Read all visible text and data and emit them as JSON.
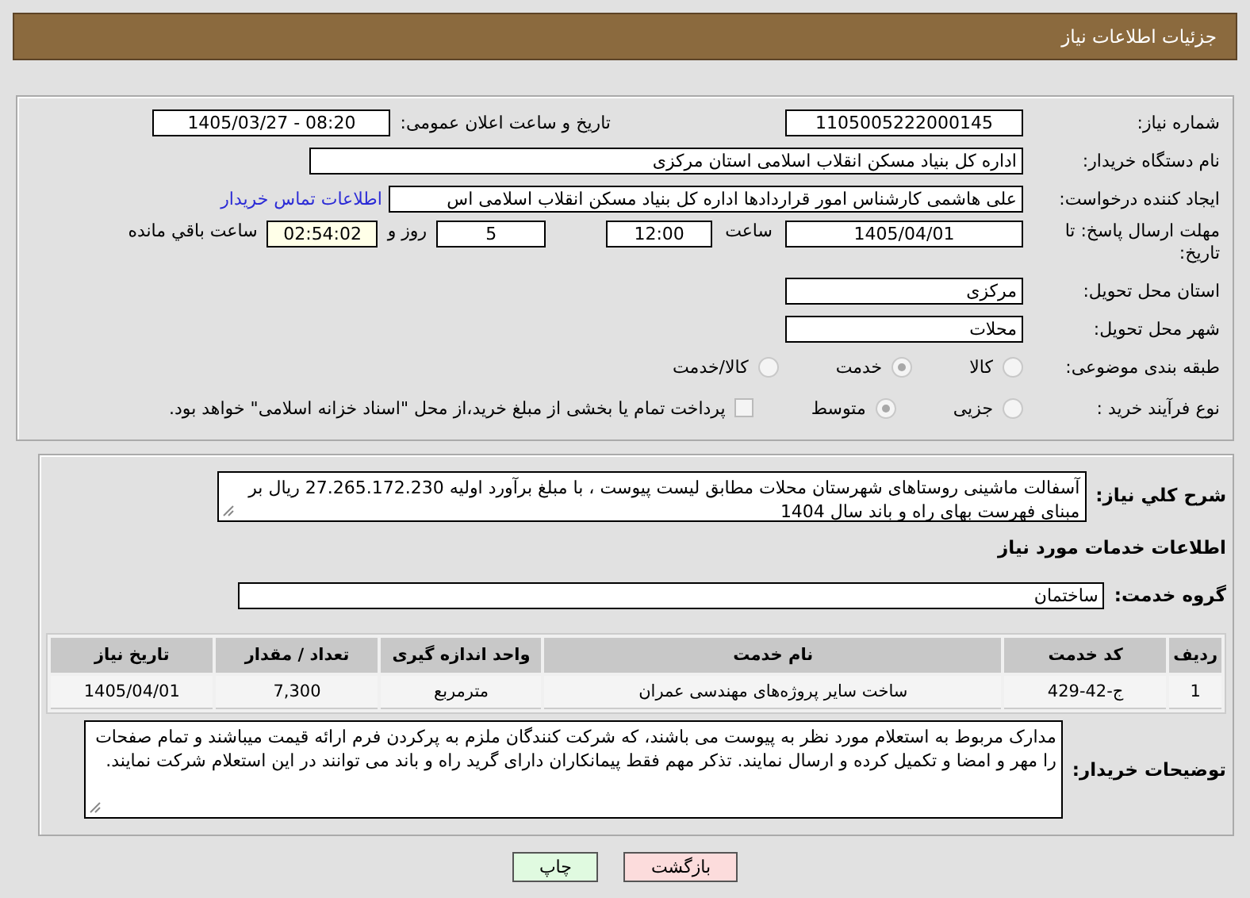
{
  "header": {
    "title": "جزئیات اطلاعات نیاز"
  },
  "details": {
    "need_number": {
      "label": "شماره نیاز:",
      "value": "1105005222000145"
    },
    "announce": {
      "label": "تاریخ و ساعت اعلان عمومی:",
      "value": "1405/03/27 - 08:20"
    },
    "buyer": {
      "label": "نام دستگاه خریدار:",
      "value": "اداره کل بنیاد مسکن انقلاب اسلامی استان مرکزی"
    },
    "creator": {
      "label": "ایجاد کننده درخواست:",
      "value": "علی هاشمی کارشناس امور قراردادها اداره کل بنیاد مسکن انقلاب اسلامی اس",
      "link": "اطلاعات تماس خریدار"
    },
    "deadline": {
      "label": "مهلت ارسال پاسخ: تا تاریخ:",
      "date": "1405/04/01",
      "time_label": "ساعت",
      "time": "12:00",
      "days": "5",
      "days_label": "روز و",
      "remaining": "02:54:02",
      "remaining_label": "ساعت باقي مانده"
    },
    "province": {
      "label": "استان محل تحویل:",
      "value": "مرکزی"
    },
    "city": {
      "label": "شهر محل تحویل:",
      "value": "محلات"
    },
    "category": {
      "label": "طبقه بندی موضوعی:",
      "options": [
        {
          "label": "کالا",
          "selected": false
        },
        {
          "label": "خدمت",
          "selected": true
        },
        {
          "label": "کالا/خدمت",
          "selected": false
        }
      ]
    },
    "process": {
      "label": "نوع فرآیند خرید :",
      "options": [
        {
          "label": "جزیی",
          "selected": false
        },
        {
          "label": "متوسط",
          "selected": true
        }
      ],
      "payment": {
        "checked": false,
        "text": "پرداخت تمام یا بخشی از مبلغ خرید،از محل \"اسناد خزانه اسلامی\" خواهد بود."
      }
    }
  },
  "need": {
    "label": "شرح کلي نياز:",
    "description": "آسفالت ماشینی روستاهای شهرستان محلات مطابق لیست پیوست ، با مبلغ برآورد اولیه  27.265.172.230 ریال بر مبنای فهرست بهای راه و باند سال 1404",
    "services_title": "اطلاعات خدمات مورد نیاز",
    "group": {
      "label": "گروه خدمت:",
      "value": "ساختمان"
    },
    "table": {
      "columns": [
        "ردیف",
        "کد خدمت",
        "نام خدمت",
        "واحد اندازه گیری",
        "تعداد / مقدار",
        "تاریخ نیاز"
      ],
      "rows": [
        [
          "1",
          "ج-42-429",
          "ساخت سایر پروژه‌های مهندسی عمران",
          "مترمربع",
          "7,300",
          "1405/04/01"
        ]
      ]
    },
    "notes": {
      "label": "توضیحات خریدار:",
      "text": "مدارک مربوط به استعلام مورد نظر به پیوست می باشند، که شرکت کنندگان ملزم به پرکردن فرم ارائه قیمت میباشند و تمام صفحات را مهر و امضا و تکمیل کرده و ارسال نمایند. تذکر مهم فقط پیمانکاران دارای گرید راه و باند می توانند در این استعلام شرکت نمایند."
    }
  },
  "buttons": [
    {
      "label": "بازگشت",
      "kind": "back"
    },
    {
      "label": "چاپ",
      "kind": "print"
    }
  ]
}
